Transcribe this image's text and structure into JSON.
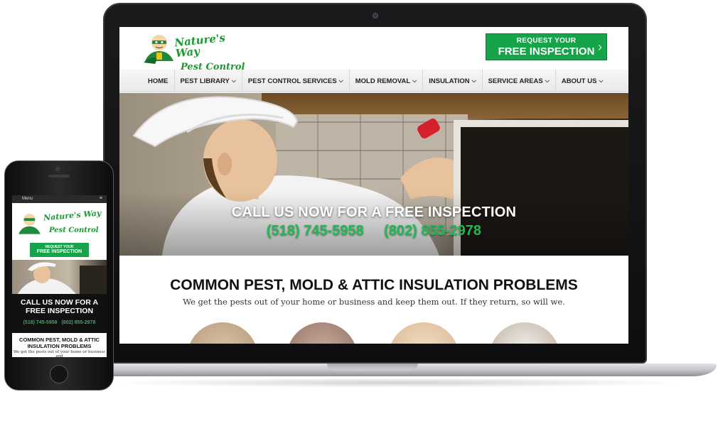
{
  "site": {
    "logo": {
      "line1": "Nature's Way",
      "line2": "Pest Control"
    },
    "cta": {
      "line1": "REQUEST YOUR",
      "line2": "FREE INSPECTION"
    },
    "nav": [
      {
        "label": "HOME",
        "dropdown": false
      },
      {
        "label": "PEST LIBRARY",
        "dropdown": true
      },
      {
        "label": "PEST CONTROL SERVICES",
        "dropdown": true
      },
      {
        "label": "MOLD REMOVAL",
        "dropdown": true
      },
      {
        "label": "INSULATION",
        "dropdown": true
      },
      {
        "label": "SERVICE AREAS",
        "dropdown": true
      },
      {
        "label": "ABOUT US",
        "dropdown": true
      }
    ],
    "hero": {
      "title": "CALL US NOW FOR A FREE INSPECTION",
      "phone1": "(518) 745-5958",
      "phone2": "(802) 855-2978"
    },
    "section": {
      "title": "COMMON PEST, MOLD & ATTIC INSULATION PROBLEMS",
      "subtitle": "We get the pests out of your home or business and keep them out. If they return, so will we."
    }
  },
  "mobile": {
    "menu_label": "Menu",
    "menu_icon": "≡",
    "cta": {
      "line1": "REQUEST YOUR",
      "line2": "FREE INSPECTION"
    },
    "hero_title": "CALL US NOW FOR A FREE INSPECTION",
    "phone1": "(518) 745-5958",
    "phone2": "(802) 855-2978",
    "section_title": "COMMON PEST, MOLD & ATTIC INSULATION PROBLEMS",
    "section_subtitle": "We get the pests out of your home or business and"
  },
  "colors": {
    "brand_green": "#16a34a",
    "phone_green": "#1fba52",
    "logo_green": "#1a9a2f"
  }
}
